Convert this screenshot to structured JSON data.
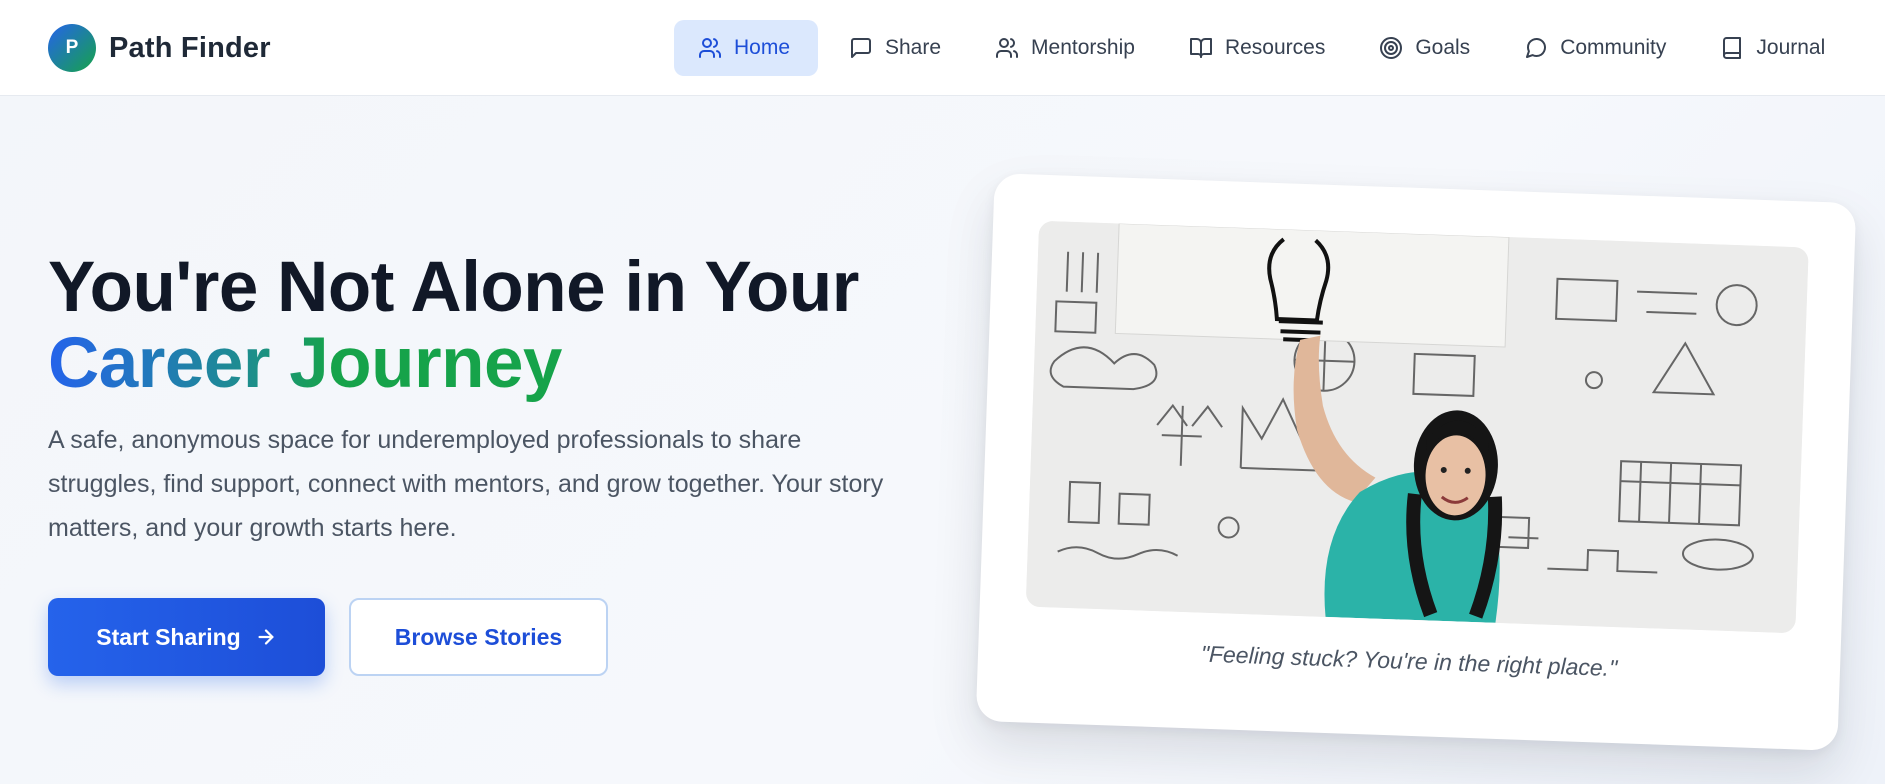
{
  "brand": {
    "logo_letter": "P",
    "name": "Path Finder"
  },
  "nav": {
    "items": [
      {
        "label": "Home",
        "icon": "users-icon",
        "active": true
      },
      {
        "label": "Share",
        "icon": "message-square-icon"
      },
      {
        "label": "Mentorship",
        "icon": "users-icon"
      },
      {
        "label": "Resources",
        "icon": "book-open-icon"
      },
      {
        "label": "Goals",
        "icon": "target-icon"
      },
      {
        "label": "Community",
        "icon": "message-circle-icon"
      },
      {
        "label": "Journal",
        "icon": "book-icon"
      }
    ]
  },
  "hero": {
    "title_line1": "You're Not Alone in Your",
    "title_line2": "Career Journey",
    "subtitle": "A safe, anonymous space for underemployed professionals to share struggles, find support, connect with mentors, and grow together. Your story matters, and your growth starts here.",
    "primary_button": "Start Sharing",
    "primary_button_icon": "arrow-right-icon",
    "secondary_button": "Browse Stories"
  },
  "card": {
    "image_alt": "Woman holding a lightbulb sketch in front of a whiteboard wall covered with doodles",
    "caption": "\"Feeling stuck? You're in the right place.\""
  },
  "colors": {
    "primary": "#2563eb",
    "primary_dark": "#1d4ed8",
    "accent_green": "#16a34a",
    "active_nav_bg": "#dbe8fd",
    "text_dark": "#111827",
    "text_muted": "#4b5563"
  }
}
